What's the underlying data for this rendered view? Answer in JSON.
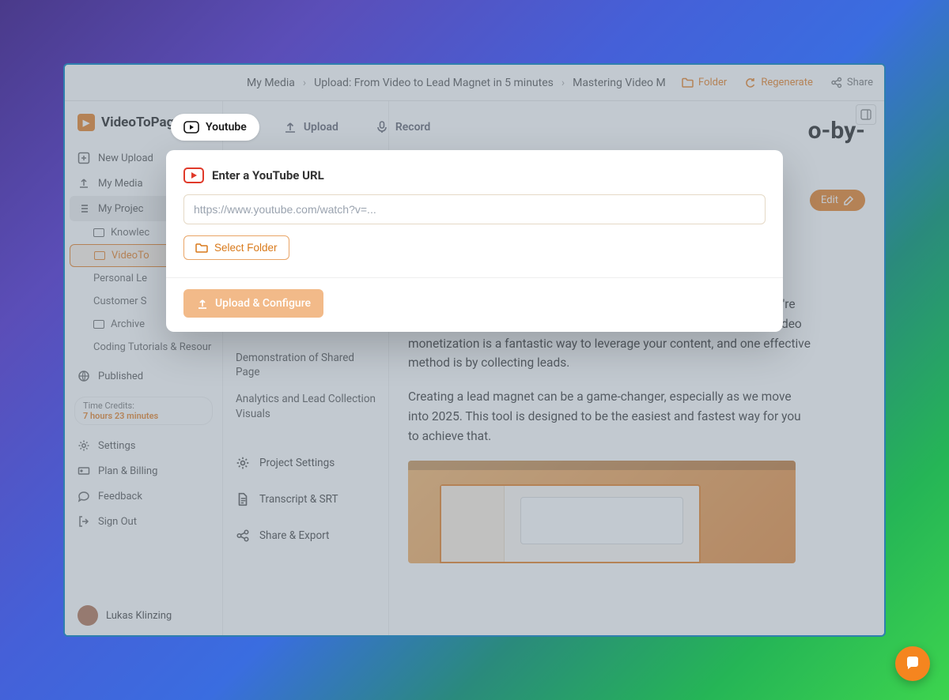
{
  "app": {
    "name": "VideoToPage"
  },
  "breadcrumbs": {
    "a": "My Media",
    "b": "Upload: From Video to Lead Magnet in 5 minutes",
    "c": "Mastering Video M"
  },
  "topActions": {
    "folder": "Folder",
    "regenerate": "Regenerate",
    "share": "Share"
  },
  "sidebar": {
    "newUpload": "New Upload",
    "myMedia": "My Media",
    "myProjects": "My Projec",
    "projects": {
      "a": "Knowlec",
      "b": "VideoTo",
      "c": "Personal Le",
      "d": "Customer S",
      "e": "Archive",
      "f": "Coding Tutorials & Resour"
    },
    "published": "Published",
    "timeCreditsLabel": "Time Credits:",
    "timeCreditsValue": "7 hours 23 minutes",
    "settings": "Settings",
    "plan": "Plan & Billing",
    "feedback": "Feedback",
    "signout": "Sign Out",
    "userName": "Lukas Klinzing"
  },
  "middle": {
    "a": "Demonstration of Shared Page",
    "b": "Analytics and Lead Collection Visuals",
    "settings": "Project Settings",
    "transcript": "Transcript & SRT",
    "share": "Share & Export"
  },
  "content": {
    "titleFragment": "o-by-",
    "edit": "Edit",
    "p1": "Hey there! If you have your own videos or a YouTube channel and you're looking to start monetizing your audience, you're in the right place. Video monetization is a fantastic way to leverage your content, and one effective method is by collecting leads.",
    "p2": "Creating a lead magnet can be a game-changer, especially as we move into 2025. This tool is designed to be the easiest and fastest way for you to achieve that."
  },
  "modal": {
    "tabs": {
      "youtube": "Youtube",
      "upload": "Upload",
      "record": "Record"
    },
    "title": "Enter a YouTube URL",
    "placeholder": "https://www.youtube.com/watch?v=...",
    "selectFolder": "Select Folder",
    "submit": "Upload & Configure"
  }
}
